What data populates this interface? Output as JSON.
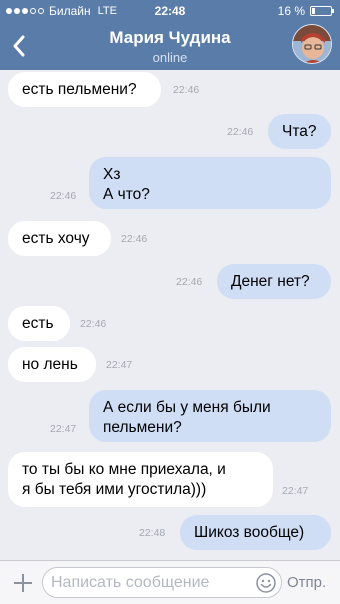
{
  "status_bar": {
    "carrier": "Билайн",
    "network": "LTE",
    "time": "22:48",
    "battery_percent": "16 %",
    "battery_level": 0.16,
    "signal_bars_filled": 3,
    "signal_bars_total": 5
  },
  "header": {
    "back_icon": "chevron-left-icon",
    "contact_name": "Мария Чудина",
    "status": "online"
  },
  "messages": [
    {
      "direction": "in",
      "lines": [
        "есть пельмени?"
      ],
      "time": "22:46"
    },
    {
      "direction": "out",
      "lines": [
        "Чта?"
      ],
      "time": "22:46"
    },
    {
      "direction": "out",
      "lines": [
        "Хз",
        "А что?"
      ],
      "time": "22:46"
    },
    {
      "direction": "in",
      "lines": [
        "есть хочу"
      ],
      "time": "22:46"
    },
    {
      "direction": "out",
      "lines": [
        "Денег нет?"
      ],
      "time": "22:46"
    },
    {
      "direction": "in",
      "lines": [
        "есть"
      ],
      "time": "22:46"
    },
    {
      "direction": "in",
      "lines": [
        "но лень"
      ],
      "time": "22:47"
    },
    {
      "direction": "out",
      "lines": [
        "А если бы у меня были",
        "пельмени?"
      ],
      "time": "22:47"
    },
    {
      "direction": "in",
      "lines": [
        "то ты бы ко мне приехала, и",
        "я бы тебя ими угостила)))"
      ],
      "time": "22:47"
    },
    {
      "direction": "out",
      "lines": [
        "Шикоз вообще)"
      ],
      "time": "22:48"
    }
  ],
  "composer": {
    "placeholder": "Написать сообщение",
    "send_label": "Отпр.",
    "attach_icon": "plus-icon",
    "emoji_icon": "smiley-icon"
  },
  "colors": {
    "header_bg": "#5a7ca8",
    "chat_bg": "#ecedf2",
    "incoming_bubble": "#ffffff",
    "outgoing_bubble": "#cfddf5",
    "timestamp": "#a4a9b2"
  }
}
